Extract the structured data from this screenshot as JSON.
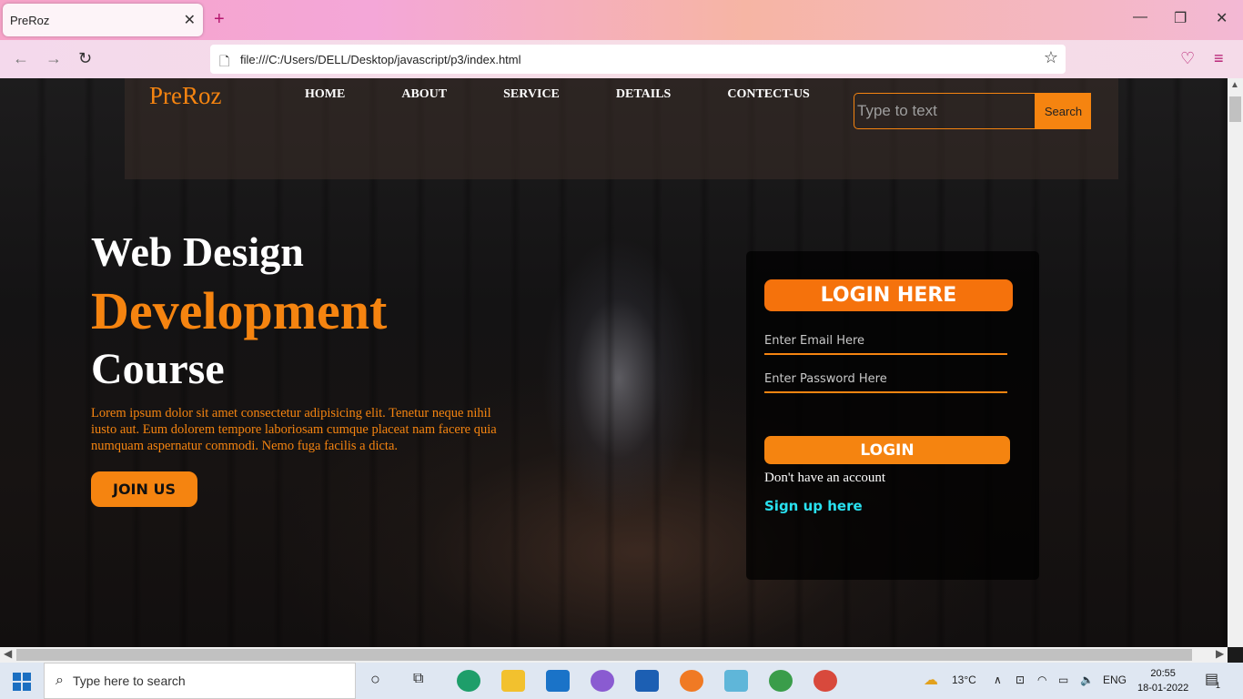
{
  "browser": {
    "tab_title": "PreRoz",
    "tab_close": "✕",
    "new_tab": "+",
    "url": "file:///C:/Users/DELL/Desktop/javascript/p3/index.html"
  },
  "site": {
    "logo": "PreRoz",
    "menu": [
      "HOME",
      "ABOUT",
      "SERVICE",
      "DETAILS",
      "CONTECT-US"
    ],
    "search_placeholder": "Type to text",
    "search_button": "Search"
  },
  "hero": {
    "line1": "Web Design",
    "line2": "Development",
    "line3": "Course",
    "paragraph": "Lorem ipsum dolor sit amet consectetur adipisicing elit. Tenetur neque nihil iusto aut. Eum dolorem tempore laboriosam cumque placeat nam facere quia numquam aspernatur commodi. Nemo fuga facilis a dicta.",
    "join_button": "JOIN US"
  },
  "login": {
    "heading": "LOGIN HERE",
    "email_placeholder": "Enter Email Here",
    "password_placeholder": "Enter Password Here",
    "login_button": "LOGIN",
    "no_account": "Don't have an account",
    "signup_link": "Sign up here"
  },
  "taskbar": {
    "search_placeholder": "Type here to search",
    "weather": "13°C",
    "language": "ENG",
    "time": "20:55",
    "date": "18-01-2022",
    "notification_count": "1"
  },
  "colors": {
    "accent": "#f58410",
    "login_header": "#f5720c",
    "signup_link": "#29e1f0"
  }
}
